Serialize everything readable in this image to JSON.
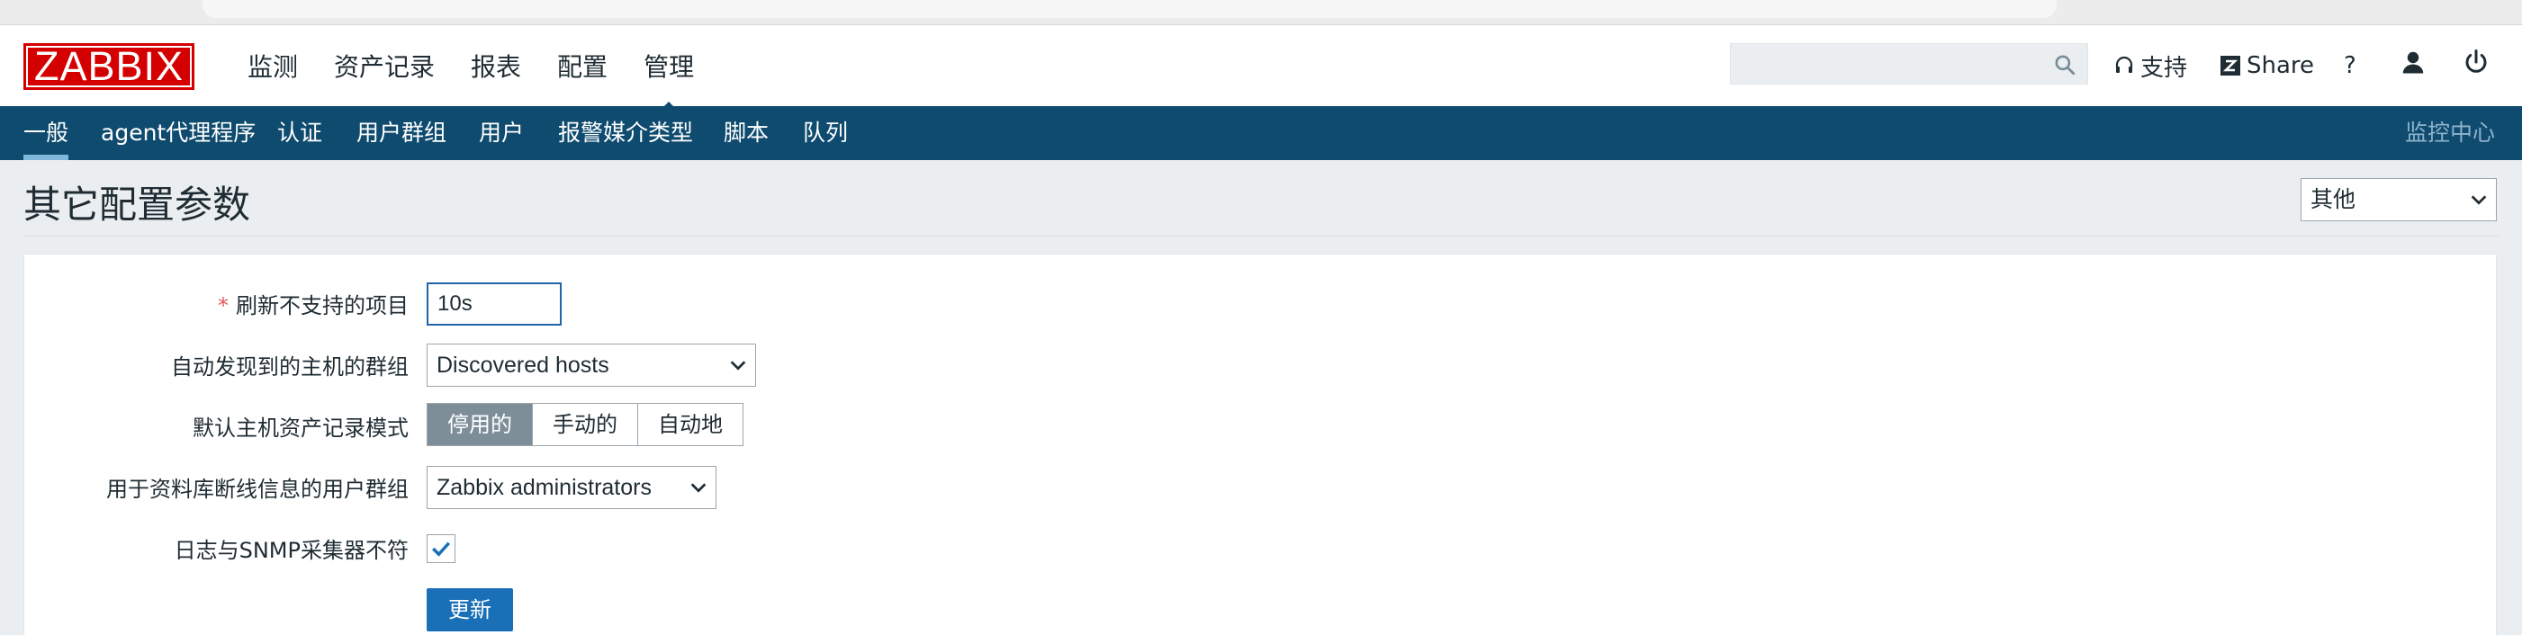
{
  "app": {
    "logo": "ZABBIX",
    "main_menu": [
      "监测",
      "资产记录",
      "报表",
      "配置",
      "管理"
    ],
    "active_main_menu": "管理",
    "header_links": {
      "support": "支持",
      "share": "Share",
      "help": "?"
    },
    "search": {
      "value": "",
      "placeholder": ""
    }
  },
  "sub_nav": {
    "items": [
      "一般",
      "agent代理程序",
      "认证",
      "用户群组",
      "用户",
      "报警媒介类型",
      "脚本",
      "队列"
    ],
    "active": "一般",
    "right_label": "监控中心"
  },
  "page": {
    "title": "其它配置参数",
    "section_select": "其他"
  },
  "form": {
    "refresh_unsupported": {
      "label": "刷新不支持的项目",
      "required_mark": "*",
      "value": "10s"
    },
    "discovery_group": {
      "label": "自动发现到的主机的群组",
      "value": "Discovered hosts"
    },
    "inventory_mode": {
      "label": "默认主机资产记录模式",
      "options": [
        "停用的",
        "手动的",
        "自动地"
      ],
      "selected": "停用的"
    },
    "db_down_group": {
      "label": "用于资料库断线信息的用户群组",
      "value": "Zabbix administrators"
    },
    "snmp_log": {
      "label": "日志与SNMP采集器不符",
      "checked": true
    },
    "submit_label": "更新"
  },
  "colors": {
    "brand": "#d40000",
    "nav_bg": "#0e4b6f",
    "primary_button": "#1a70b6",
    "segment_selected": "#7e8e99"
  }
}
